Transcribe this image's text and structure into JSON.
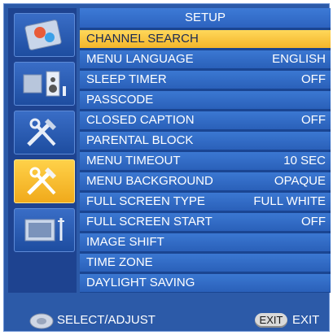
{
  "menu": {
    "title": "SETUP",
    "items": [
      {
        "label": "CHANNEL SEARCH",
        "value": ""
      },
      {
        "label": "MENU LANGUAGE",
        "value": "ENGLISH"
      },
      {
        "label": "SLEEP TIMER",
        "value": "OFF"
      },
      {
        "label": "PASSCODE",
        "value": ""
      },
      {
        "label": "CLOSED CAPTION",
        "value": "OFF"
      },
      {
        "label": "PARENTAL BLOCK",
        "value": ""
      },
      {
        "label": "MENU TIMEOUT",
        "value": "10 SEC"
      },
      {
        "label": "MENU BACKGROUND",
        "value": "OPAQUE"
      },
      {
        "label": "FULL SCREEN TYPE",
        "value": "FULL WHITE"
      },
      {
        "label": "FULL SCREEN START",
        "value": "OFF"
      },
      {
        "label": "IMAGE SHIFT",
        "value": ""
      },
      {
        "label": "TIME ZONE",
        "value": ""
      },
      {
        "label": "DAYLIGHT SAVING",
        "value": ""
      }
    ],
    "selected_index": 0
  },
  "sidebar": {
    "items": [
      {
        "icon": "picture-icon",
        "active": false
      },
      {
        "icon": "audio-icon",
        "active": false
      },
      {
        "icon": "tools-icon",
        "active": false
      },
      {
        "icon": "setup-tools-icon",
        "active": true
      },
      {
        "icon": "tv-antenna-icon",
        "active": false
      }
    ]
  },
  "footer": {
    "select_label": "SELECT/ADJUST",
    "exit_key": "EXIT",
    "exit_label": "EXIT"
  },
  "colors": {
    "panel": "#2c5aa8",
    "row": "#3b78d2",
    "active": "#f3b52a"
  }
}
